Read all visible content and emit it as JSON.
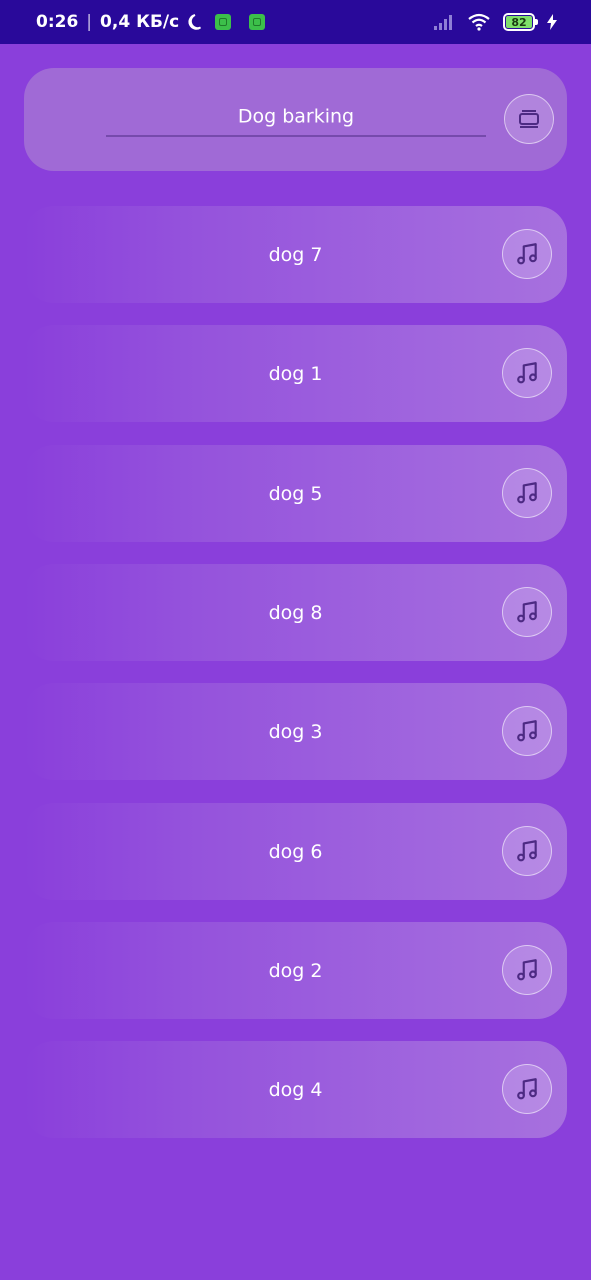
{
  "status_bar": {
    "time": "0:26",
    "network_speed": "0,4 КБ/с",
    "battery_level": "82",
    "icons": [
      "moon-icon",
      "notification-icon",
      "notification-icon",
      "signal-icon",
      "wifi-icon",
      "battery-icon",
      "charging-icon"
    ]
  },
  "search": {
    "value": "Dog barking",
    "action_icon": "collection-icon"
  },
  "sounds": [
    {
      "label": "dog 7",
      "icon": "music-note-icon"
    },
    {
      "label": "dog 1",
      "icon": "music-note-icon"
    },
    {
      "label": "dog 5",
      "icon": "music-note-icon"
    },
    {
      "label": "dog 8",
      "icon": "music-note-icon"
    },
    {
      "label": "dog 3",
      "icon": "music-note-icon"
    },
    {
      "label": "dog 6",
      "icon": "music-note-icon"
    },
    {
      "label": "dog 2",
      "icon": "music-note-icon"
    },
    {
      "label": "dog 4",
      "icon": "music-note-icon"
    }
  ],
  "colors": {
    "background": "#8a3fdb",
    "status_bar": "#29099a",
    "card": "#a06ad6",
    "icon": "#4d2a83"
  }
}
